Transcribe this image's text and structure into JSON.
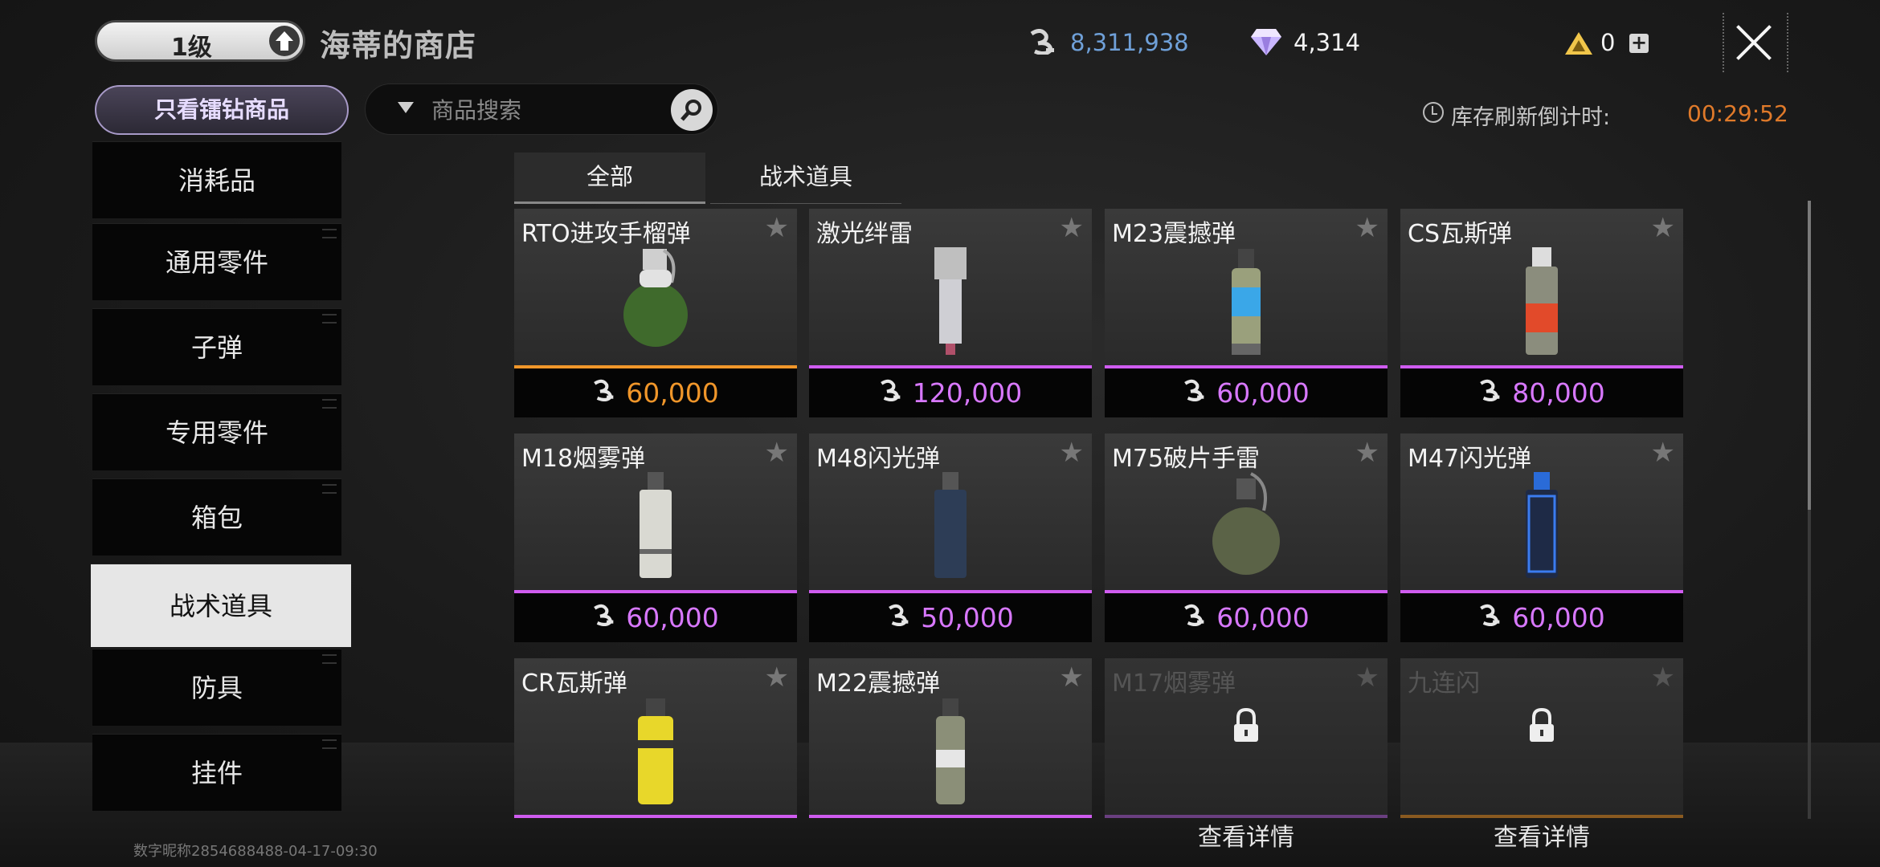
{
  "header": {
    "level_label": "1级",
    "shop_title": "海蒂的商店",
    "currency_money": "8,311,938",
    "currency_gem": "4,314",
    "currency_triangle": "0",
    "plus_label": "+"
  },
  "filters": {
    "diamond_only_label": "只看镭钻商品",
    "search_placeholder": "商品搜索",
    "refresh_label": "库存刷新倒计时:",
    "refresh_time": "00:29:52"
  },
  "sidebar": {
    "items": [
      {
        "label": "消耗品"
      },
      {
        "label": "通用零件"
      },
      {
        "label": "子弹"
      },
      {
        "label": "专用零件"
      },
      {
        "label": "箱包"
      },
      {
        "label": "战术道具",
        "active": true
      },
      {
        "label": "防具"
      },
      {
        "label": "挂件"
      }
    ]
  },
  "tabs": [
    {
      "label": "全部",
      "active": true
    },
    {
      "label": "战术道具",
      "active": false
    }
  ],
  "items": [
    {
      "name": "RTO进攻手榴弹",
      "price": "60,000",
      "rarity": "orange"
    },
    {
      "name": "激光绊雷",
      "price": "120,000",
      "rarity": "purple"
    },
    {
      "name": "M23震撼弹",
      "price": "60,000",
      "rarity": "purple"
    },
    {
      "name": "CS瓦斯弹",
      "price": "80,000",
      "rarity": "purple"
    },
    {
      "name": "M18烟雾弹",
      "price": "60,000",
      "rarity": "purple"
    },
    {
      "name": "M48闪光弹",
      "price": "50,000",
      "rarity": "purple"
    },
    {
      "name": "M75破片手雷",
      "price": "60,000",
      "rarity": "purple"
    },
    {
      "name": "M47闪光弹",
      "price": "60,000",
      "rarity": "purple"
    },
    {
      "name": "CR瓦斯弹",
      "price": "",
      "rarity": "purple"
    },
    {
      "name": "M22震撼弹",
      "price": "",
      "rarity": "purple"
    },
    {
      "name": "M17烟雾弹",
      "locked": true,
      "detail": "查看详情",
      "rarity": "purple"
    },
    {
      "name": "九连闪",
      "locked": true,
      "detail": "查看详情",
      "rarity": "orange"
    }
  ],
  "colors": {
    "orange": "#f0962a",
    "purple": "#cf5cf0",
    "price_orange": "#f0962a",
    "price_purple": "#d878ff"
  },
  "footer": {
    "watermark": "数字昵称2854688488-04-17-09:30"
  }
}
